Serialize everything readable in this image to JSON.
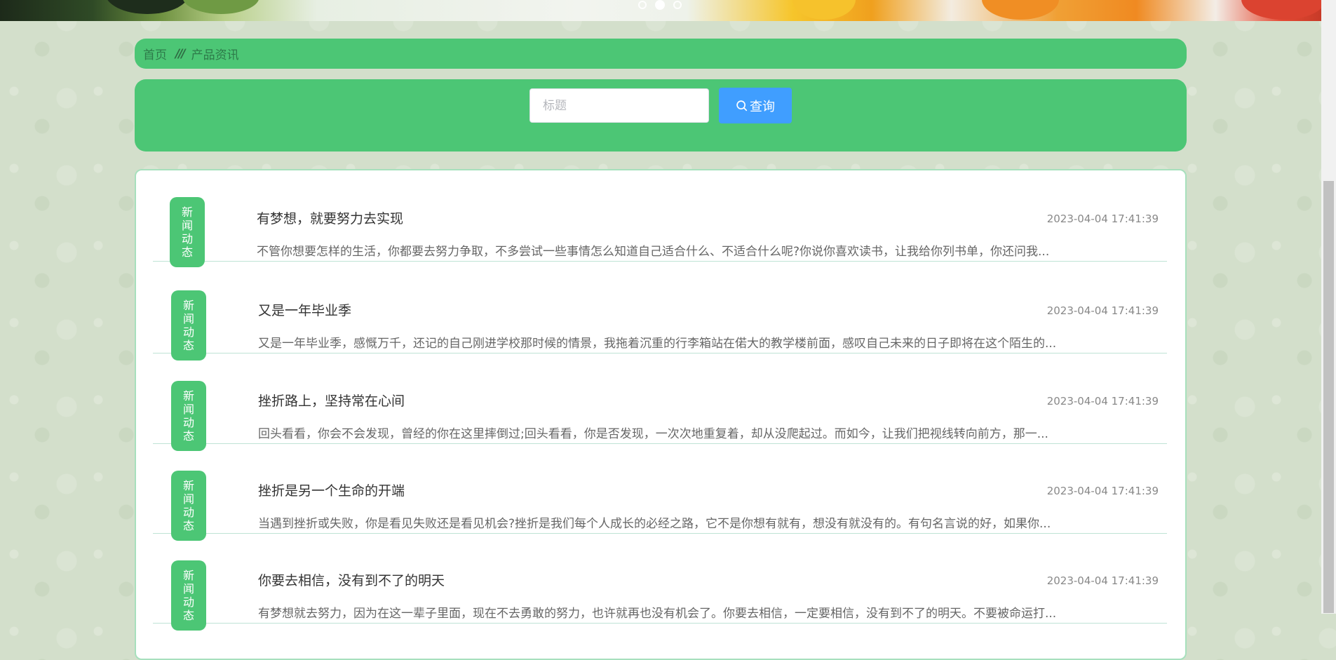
{
  "banner": {
    "dots": 3,
    "active_dot": 2
  },
  "breadcrumb": {
    "home": "首页",
    "separator": "///",
    "current": "产品资讯"
  },
  "search": {
    "placeholder": "标题",
    "button_label": "查询"
  },
  "news": {
    "items": [
      {
        "tag": "新闻动态",
        "title": "有梦想，就要努力去实现",
        "date": "2023-04-04 17:41:39",
        "summary": "不管你想要怎样的生活，你都要去努力争取，不多尝试一些事情怎么知道自己适合什么、不适合什么呢?你说你喜欢读书，让我给你列书单，你还问我..."
      },
      {
        "tag": "新闻动态",
        "title": "又是一年毕业季",
        "date": "2023-04-04 17:41:39",
        "summary": "又是一年毕业季，感慨万千，还记的自己刚进学校那时候的情景，我拖着沉重的行李箱站在偌大的教学楼前面，感叹自己未来的日子即将在这个陌生的..."
      },
      {
        "tag": "新闻动态",
        "title": "挫折路上，坚持常在心间",
        "date": "2023-04-04 17:41:39",
        "summary": "回头看看，你会不会发现，曾经的你在这里摔倒过;回头看看，你是否发现，一次次地重复着，却从没爬起过。而如今，让我们把视线转向前方，那一..."
      },
      {
        "tag": "新闻动态",
        "title": "挫折是另一个生命的开端",
        "date": "2023-04-04 17:41:39",
        "summary": "当遇到挫折或失败，你是看见失败还是看见机会?挫折是我们每个人成长的必经之路，它不是你想有就有，想没有就没有的。有句名言说的好，如果你..."
      },
      {
        "tag": "新闻动态",
        "title": "你要去相信，没有到不了的明天",
        "date": "2023-04-04 17:41:39",
        "summary": "有梦想就去努力，因为在这一辈子里面，现在不去勇敢的努力，也许就再也没有机会了。你要去相信，一定要相信，没有到不了的明天。不要被命运打..."
      }
    ]
  }
}
